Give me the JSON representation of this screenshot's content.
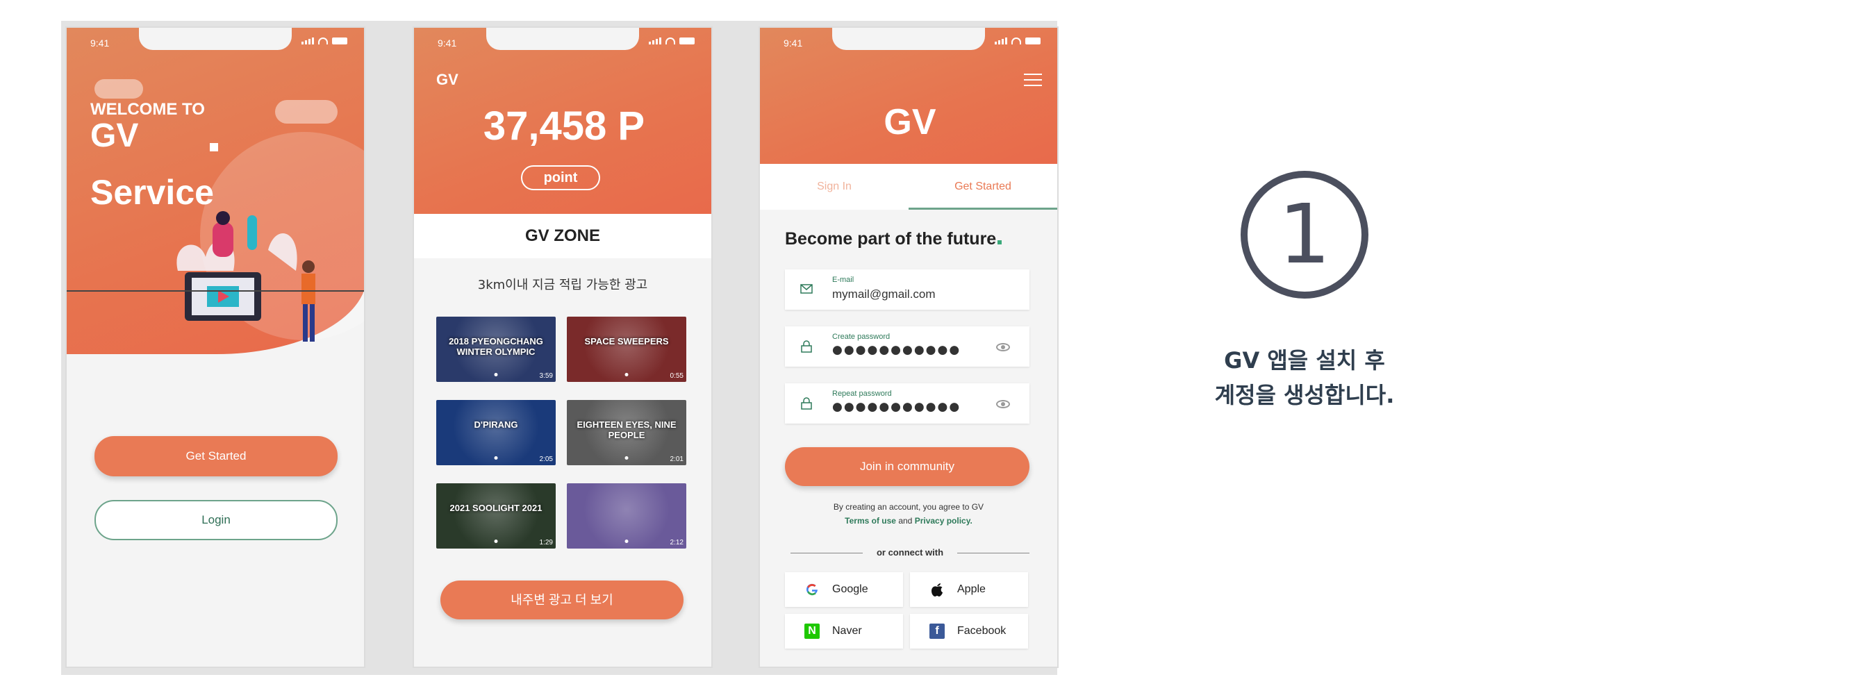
{
  "status": {
    "time": "9:41"
  },
  "phone1": {
    "welcome_line1": "WELCOME TO",
    "welcome_line2": "GV",
    "welcome_line3": "Service",
    "get_started": "Get Started",
    "login": "Login"
  },
  "phone2": {
    "brand": "GV",
    "points": "37,458 P",
    "point_label": "point",
    "zone_title": "GV ZONE",
    "zone_subtitle": "3km이내 지금 적립 가능한 광고",
    "ads": [
      {
        "title": "2018 PYEONGCHANG WINTER OLYMPIC",
        "duration": "3:59",
        "color": "#2a3a6a"
      },
      {
        "title": "SPACE SWEEPERS",
        "duration": "0:55",
        "color": "#7a2a2a"
      },
      {
        "title": "D'PIRANG",
        "duration": "2:05",
        "color": "#1a3a7a"
      },
      {
        "title": "EIGHTEEN EYES, NINE PEOPLE",
        "duration": "2:01",
        "color": "#5a5a5a"
      },
      {
        "title": "2021 SOOLIGHT 2021",
        "duration": "1:29",
        "color": "#2a3a2a"
      },
      {
        "title": "",
        "duration": "2:12",
        "color": "#6a5a9a"
      }
    ],
    "more_button": "내주변 광고 더 보기"
  },
  "phone3": {
    "brand": "GV",
    "tab_signin": "Sign In",
    "tab_getstarted": "Get Started",
    "headline": "Become part of the future",
    "email_label": "E-mail",
    "email_value": "mymail@gmail.com",
    "create_pw_label": "Create password",
    "repeat_pw_label": "Repeat password",
    "password_mask": "●●●●●●●●●●●",
    "join_button": "Join in community",
    "terms_line1": "By creating an account, you agree to GV",
    "terms_link1": "Terms of use",
    "terms_and": "and",
    "terms_link2": "Privacy policy.",
    "connect_with": "or connect with",
    "social": {
      "google": "Google",
      "apple": "Apple",
      "naver": "Naver",
      "facebook": "Facebook"
    }
  },
  "step": {
    "number": "1",
    "caption_line1": "GV 앱을 설치 후",
    "caption_line2": "계정을 생성합니다."
  },
  "colors": {
    "accent": "#e97a55",
    "green": "#6da48b",
    "dark": "#2f3e4e"
  }
}
